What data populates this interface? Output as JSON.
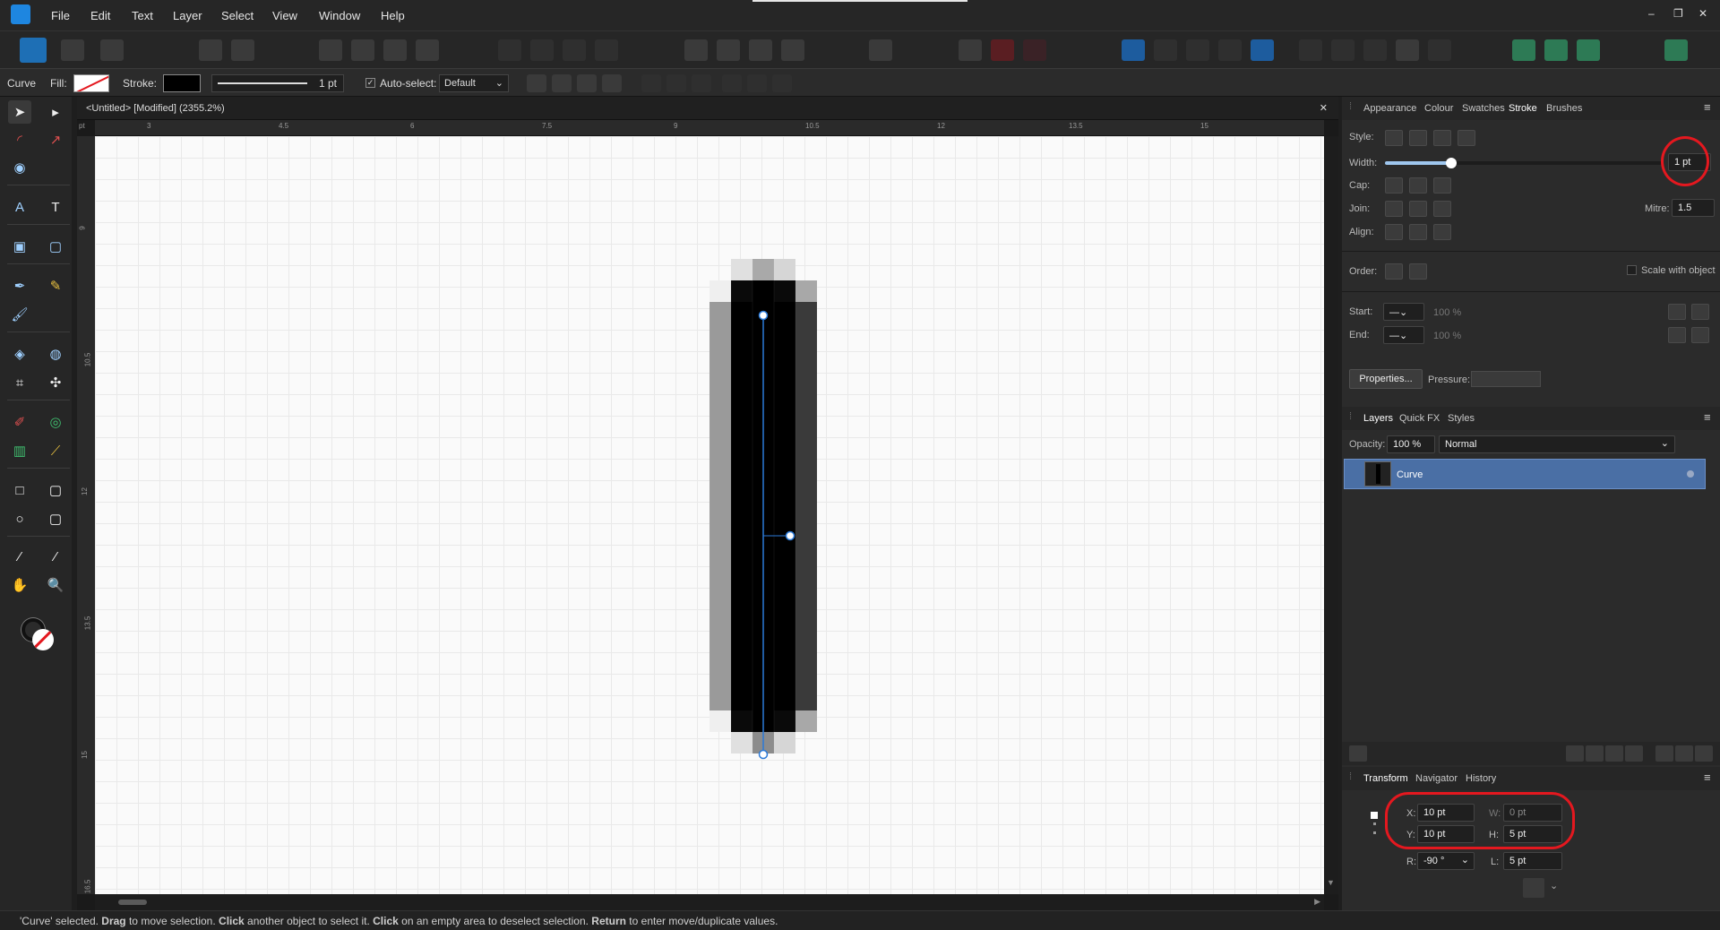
{
  "menu": {
    "items": [
      "File",
      "Edit",
      "Text",
      "Layer",
      "Select",
      "View",
      "Window",
      "Help"
    ]
  },
  "window_controls": {
    "minimize": "–",
    "restore": "❐",
    "close": "✕"
  },
  "context_toolbar": {
    "object_type": "Curve",
    "fill_label": "Fill:",
    "stroke_label": "Stroke:",
    "stroke_width": "1 pt",
    "auto_select_label": "Auto-select:",
    "auto_select_value": "Default"
  },
  "document": {
    "tab_title": "<Untitled> [Modified] (2355.2%)",
    "close": "✕",
    "ruler_unit": "pt",
    "ruler_h_ticks": [
      "3",
      "4.5",
      "6",
      "7.5",
      "9",
      "10.5",
      "12",
      "13.5",
      "15"
    ],
    "ruler_v_ticks": [
      "9",
      "10.5",
      "12",
      "13.5",
      "15",
      "16.5"
    ]
  },
  "stroke_panel": {
    "tabs": [
      "Appearance",
      "Colour",
      "Swatches",
      "Stroke",
      "Brushes"
    ],
    "active_tab": "Stroke",
    "style_label": "Style:",
    "width_label": "Width:",
    "width_value": "1 pt",
    "width_fraction": 0.24,
    "cap_label": "Cap:",
    "join_label": "Join:",
    "align_label": "Align:",
    "mitre_label": "Mitre:",
    "mitre_value": "1.5",
    "order_label": "Order:",
    "scale_with_object_label": "Scale with object",
    "start_label": "Start:",
    "end_label": "End:",
    "start_pct": "100 %",
    "end_pct": "100 %",
    "properties_button": "Properties...",
    "pressure_label": "Pressure:"
  },
  "layers_panel": {
    "tabs": [
      "Layers",
      "Quick FX",
      "Styles"
    ],
    "opacity_label": "Opacity:",
    "opacity_value": "100 %",
    "blend_mode": "Normal",
    "layers": [
      {
        "name": "Curve"
      }
    ]
  },
  "transform_panel": {
    "tabs": [
      "Transform",
      "Navigator",
      "History"
    ],
    "x_label": "X:",
    "x_value": "10 pt",
    "y_label": "Y:",
    "y_value": "10 pt",
    "w_label": "W:",
    "w_value": "0 pt",
    "h_label": "H:",
    "h_value": "5 pt",
    "r_label": "R:",
    "r_value": "-90 °",
    "l_label": "L:",
    "l_value": "5 pt"
  },
  "status": {
    "s1": "'Curve' selected. ",
    "b1": "Drag",
    "s2": " to move selection. ",
    "b2": "Click",
    "s3": " another object to select it. ",
    "b3": "Click",
    "s4": " on an empty area to deselect selection. ",
    "b4": "Return",
    "s5": " to enter move/duplicate values."
  },
  "colors": {
    "accent": "#1e86e0",
    "selection": "#4a6fa5",
    "annotation": "#e4181f"
  }
}
